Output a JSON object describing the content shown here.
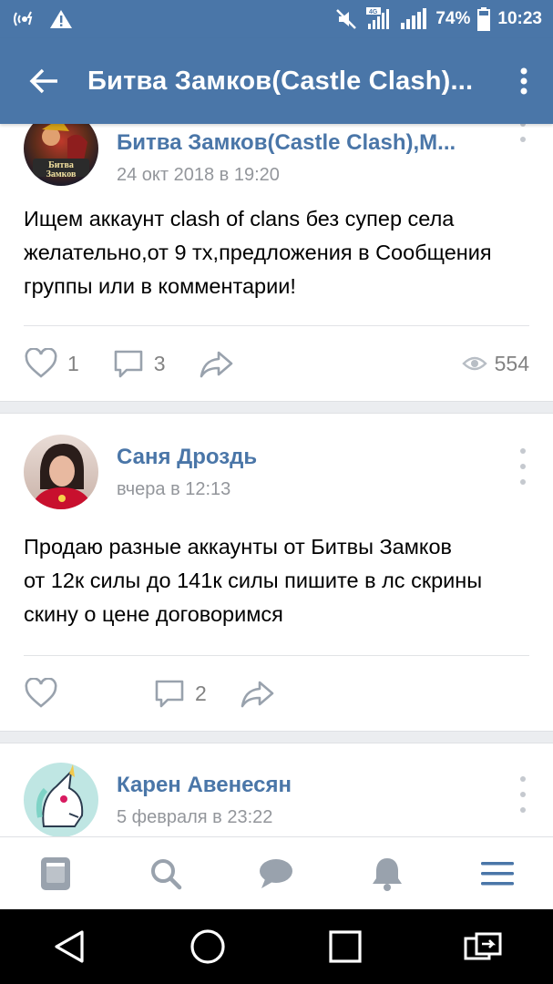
{
  "status_bar": {
    "battery_percent": "74%",
    "time": "10:23",
    "network": "4G",
    "icons": [
      "wifi-calling-icon",
      "warning-icon",
      "mute-icon",
      "signal-icon",
      "battery-icon"
    ]
  },
  "header": {
    "back_icon": "arrow-left-icon",
    "title": "Битва Замков(Castle Clash)...",
    "more_icon": "more-vertical-icon"
  },
  "posts": [
    {
      "author": "Битва Замков(Castle Clash),М...",
      "date": "24 окт 2018 в 19:20",
      "text_lines": [
        "Ищем аккаунт clash of clans без супер села",
        "желательно,от 9 тх,предложения в Сообщения",
        "группы или в комментарии!"
      ],
      "likes": "1",
      "comments": "3",
      "views": "554",
      "avatar_label": "Битва Замков"
    },
    {
      "author": "Саня Дроздь",
      "date": "вчера в 12:13",
      "text_lines": [
        "Продаю разные аккаунты от Битвы Замков",
        "от 12к силы до 141к силы пишите в лс скрины",
        "скину о цене договоримся"
      ],
      "likes": "",
      "comments": "2"
    },
    {
      "author": "Карен Авенесян",
      "date": "5 февраля в 23:22"
    }
  ],
  "bottom_nav": [
    "news-icon",
    "search-icon",
    "messages-icon",
    "notifications-icon",
    "menu-icon"
  ],
  "system_nav": [
    "back-triangle-icon",
    "home-circle-icon",
    "recents-square-icon",
    "screen-switch-icon"
  ],
  "colors": {
    "brand": "#4a76a8",
    "author_name": "#4a76a8",
    "meta_text": "#93969b",
    "icon_gray": "#99a2ad",
    "background": "#ebedf0"
  }
}
